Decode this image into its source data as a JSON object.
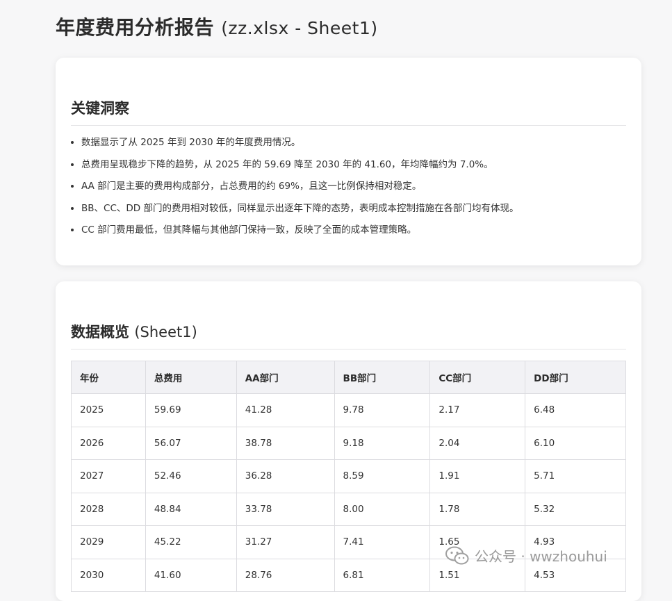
{
  "page": {
    "title": "年度费用分析报告",
    "subtitle": "(zz.xlsx - Sheet1)"
  },
  "insights": {
    "heading": "关键洞察",
    "items": [
      "数据显示了从 2025 年到 2030 年的年度费用情况。",
      "总费用呈现稳步下降的趋势，从 2025 年的 59.69 降至 2030 年的 41.60，年均降幅约为 7.0%。",
      "AA 部门是主要的费用构成部分，占总费用的约 69%，且这一比例保持相对稳定。",
      "BB、CC、DD 部门的费用相对较低，同样显示出逐年下降的态势，表明成本控制措施在各部门均有体现。",
      "CC 部门费用最低，但其降幅与其他部门保持一致，反映了全面的成本管理策略。"
    ]
  },
  "overview": {
    "heading": "数据概览",
    "heading_sub": "(Sheet1)",
    "columns": [
      "年份",
      "总费用",
      "AA部门",
      "BB部门",
      "CC部门",
      "DD部门"
    ],
    "rows": [
      [
        "2025",
        "59.69",
        "41.28",
        "9.78",
        "2.17",
        "6.48"
      ],
      [
        "2026",
        "56.07",
        "38.78",
        "9.18",
        "2.04",
        "6.10"
      ],
      [
        "2027",
        "52.46",
        "36.28",
        "8.59",
        "1.91",
        "5.71"
      ],
      [
        "2028",
        "48.84",
        "33.78",
        "8.00",
        "1.78",
        "5.32"
      ],
      [
        "2029",
        "45.22",
        "31.27",
        "7.41",
        "1.65",
        "4.93"
      ],
      [
        "2030",
        "41.60",
        "28.76",
        "6.81",
        "1.51",
        "4.53"
      ]
    ]
  },
  "watermark": {
    "text": "公众号 · wwzhouhui",
    "icon": "wechat-icon"
  }
}
